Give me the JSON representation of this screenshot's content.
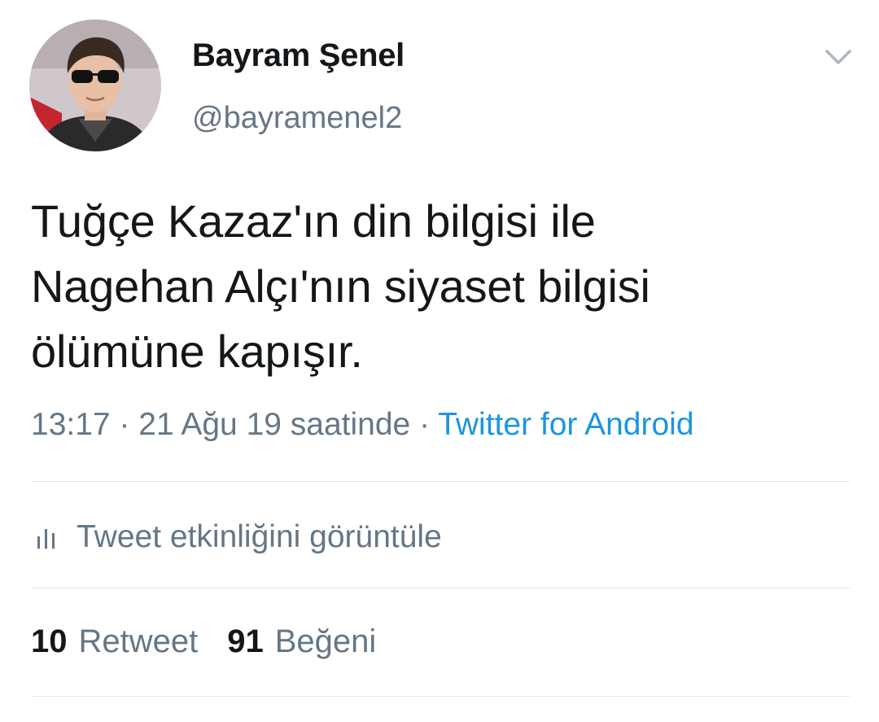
{
  "author": {
    "display_name": "Bayram Şenel",
    "handle": "@bayramenel2",
    "avatar_icon": "profile-photo"
  },
  "menu": {
    "icon": "chevron-down-icon"
  },
  "tweet": {
    "lines": [
      "Tuğçe Kazaz'ın din bilgisi ile",
      "Nagehan Alçı'nın siyaset bilgisi",
      "ölümüne kapışır."
    ]
  },
  "meta": {
    "time": "13:17",
    "separator1": " · ",
    "date": "21 Ağu 19 saatinde",
    "separator2": " · ",
    "source": "Twitter for Android"
  },
  "activity": {
    "icon": "bar-chart-icon",
    "label": "Tweet etkinliğini görüntüle"
  },
  "stats": {
    "retweet_count": "10",
    "retweet_label": "Retweet",
    "like_count": "91",
    "like_label": "Beğeni"
  },
  "colors": {
    "primary_text": "#14171a",
    "secondary_text": "#657786",
    "link": "#1b95e0",
    "divider": "#e1e8ed"
  }
}
